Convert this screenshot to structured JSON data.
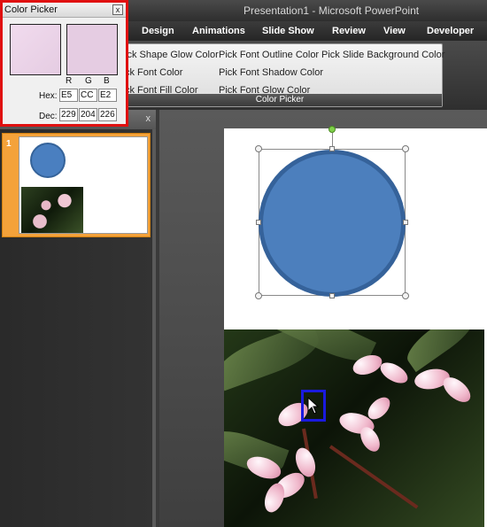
{
  "window": {
    "title": "Presentation1 - Microsoft PowerPoint"
  },
  "tabs": [
    "Design",
    "Animations",
    "Slide Show",
    "Review",
    "View",
    "Developer"
  ],
  "ribbon": {
    "group_label": "Color Picker",
    "buttons": [
      "ick Shape Glow Color",
      "Pick Font Outline Color",
      "Pick Slide Background Color",
      "ck Font Color",
      "Pick Font Shadow Color",
      "ck Font Fill Color",
      "Pick Font Glow Color"
    ]
  },
  "slide_pane": {
    "close_glyph": "x",
    "slide_number": "1"
  },
  "color_picker": {
    "title": "Color Picker",
    "close_glyph": "x",
    "swatch_color": "#E5CCE2",
    "channel_headers": [
      "R",
      "G",
      "B"
    ],
    "hex_label": "Hex:",
    "dec_label": "Dec:",
    "hex_values": [
      "E5",
      "CC",
      "E2"
    ],
    "dec_values": [
      "229",
      "204",
      "226"
    ]
  },
  "colors": {
    "shape_fill": "#4c7fbd",
    "highlight_border": "#e01010",
    "pane_selection": "#f4a23a"
  }
}
